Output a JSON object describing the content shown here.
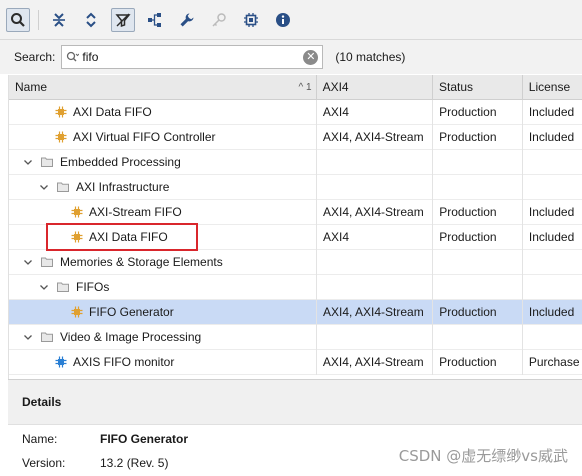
{
  "toolbar": {
    "buttons": [
      {
        "icon": "search-icon",
        "active": true
      },
      {
        "icon": "collapse-all-icon"
      },
      {
        "icon": "expand-all-icon"
      },
      {
        "icon": "filter-icon",
        "active": true
      },
      {
        "icon": "hierarchy-icon"
      },
      {
        "icon": "wrench-icon"
      },
      {
        "icon": "key-icon",
        "disabled": true
      },
      {
        "icon": "chip-icon"
      },
      {
        "icon": "info-icon"
      }
    ]
  },
  "search": {
    "label": "Search:",
    "value": "fifo",
    "match_count": "(10 matches)"
  },
  "table": {
    "headers": {
      "name": "Name",
      "sort": "^ 1",
      "interface": "AXI4",
      "status": "Status",
      "license": "License"
    },
    "rows": [
      {
        "type": "ip",
        "level": 2,
        "name": "AXI Data FIFO",
        "interface": "AXI4",
        "status": "Production",
        "license": "Included"
      },
      {
        "type": "ip",
        "level": 2,
        "name": "AXI Virtual FIFO Controller",
        "interface": "AXI4, AXI4-Stream",
        "status": "Production",
        "license": "Included"
      },
      {
        "type": "folder",
        "level": 0,
        "name": "Embedded Processing",
        "interface": "",
        "status": "",
        "license": ""
      },
      {
        "type": "folder",
        "level": 1,
        "name": "AXI Infrastructure",
        "interface": "",
        "status": "",
        "license": ""
      },
      {
        "type": "ip",
        "level": 3,
        "name": "AXI-Stream FIFO",
        "interface": "AXI4, AXI4-Stream",
        "status": "Production",
        "license": "Included"
      },
      {
        "type": "ip",
        "level": 3,
        "name": "AXI Data FIFO",
        "interface": "AXI4",
        "status": "Production",
        "license": "Included"
      },
      {
        "type": "folder",
        "level": 0,
        "name": "Memories & Storage Elements",
        "interface": "",
        "status": "",
        "license": ""
      },
      {
        "type": "folder",
        "level": 1,
        "name": "FIFOs",
        "interface": "",
        "status": "",
        "license": ""
      },
      {
        "type": "ip",
        "level": 3,
        "name": "FIFO Generator",
        "interface": "AXI4, AXI4-Stream",
        "status": "Production",
        "license": "Included",
        "selected": true
      },
      {
        "type": "folder",
        "level": 0,
        "name": "Video & Image Processing",
        "interface": "",
        "status": "",
        "license": ""
      },
      {
        "type": "ip-blue",
        "level": 2,
        "name": "AXIS FIFO monitor",
        "interface": "AXI4, AXI4-Stream",
        "status": "Production",
        "license": "Purchase"
      }
    ]
  },
  "details": {
    "title": "Details",
    "name_key": "Name:",
    "name_val": "FIFO Generator",
    "version_key": "Version:",
    "version_val": "13.2 (Rev. 5)"
  },
  "watermark": "CSDN @虚无缥缈vs威武",
  "colors": {
    "selection": "#c9daf5",
    "highlight_border": "#d9262c",
    "ip_icon": "#e0a030",
    "ip_icon_blue": "#2a7fd4"
  }
}
